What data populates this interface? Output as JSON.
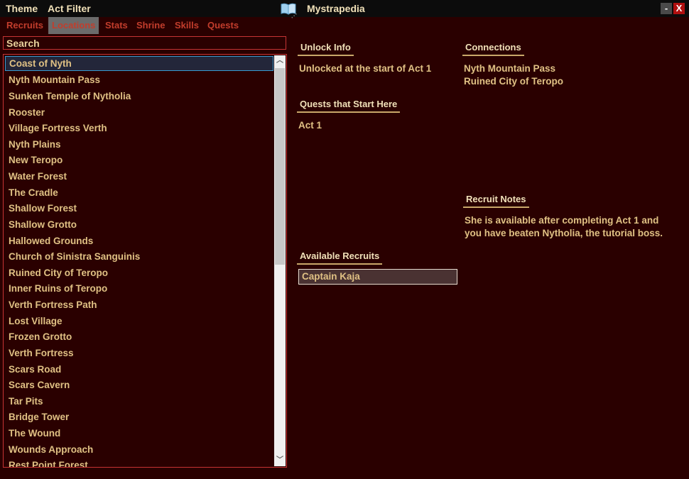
{
  "menu": {
    "theme": "Theme",
    "act_filter": "Act Filter"
  },
  "app": {
    "title": "Mystrapedia",
    "minimize": "-",
    "close": "X"
  },
  "tabs": [
    "Recruits",
    "Locations",
    "Stats",
    "Shrine",
    "Skills",
    "Quests"
  ],
  "active_tab": "Locations",
  "search": {
    "placeholder": "Search",
    "value": ""
  },
  "locations": [
    "Coast of Nyth",
    "Nyth Mountain Pass",
    "Sunken Temple of Nytholia",
    "Rooster",
    "Village Fortress Verth",
    "Nyth Plains",
    "New Teropo",
    "Water Forest",
    "The Cradle",
    "Shallow Forest",
    "Shallow Grotto",
    "Hallowed Grounds",
    "Church of Sinistra Sanguinis",
    "Ruined City of Teropo",
    "Inner Ruins of Teropo",
    "Verth Fortress Path",
    "Lost Village",
    "Frozen Grotto",
    "Verth Fortress",
    "Scars Road",
    "Scars Cavern",
    "Tar Pits",
    "Bridge Tower",
    "The Wound",
    "Wounds Approach",
    "Rest Point Forest"
  ],
  "selected_location": "Coast of Nyth",
  "details": {
    "unlock_info": {
      "heading": "Unlock Info",
      "text": "Unlocked at the start of Act 1"
    },
    "connections": {
      "heading": "Connections",
      "items": [
        "Nyth Mountain Pass",
        "Ruined City of Teropo"
      ]
    },
    "quests": {
      "heading": "Quests that Start Here",
      "items": [
        "Act 1"
      ]
    },
    "recruit_notes": {
      "heading": "Recruit Notes",
      "lines": [
        "She is available after completing Act 1 and",
        "you have beaten Nytholia, the tutorial boss."
      ]
    },
    "available_recruits": {
      "heading": "Available Recruits",
      "items": [
        "Captain Kaja"
      ]
    }
  },
  "colors": {
    "background": "#2a0000",
    "text": "#e0c184",
    "accent": "#c63434",
    "tab_text": "#c23d2c"
  }
}
